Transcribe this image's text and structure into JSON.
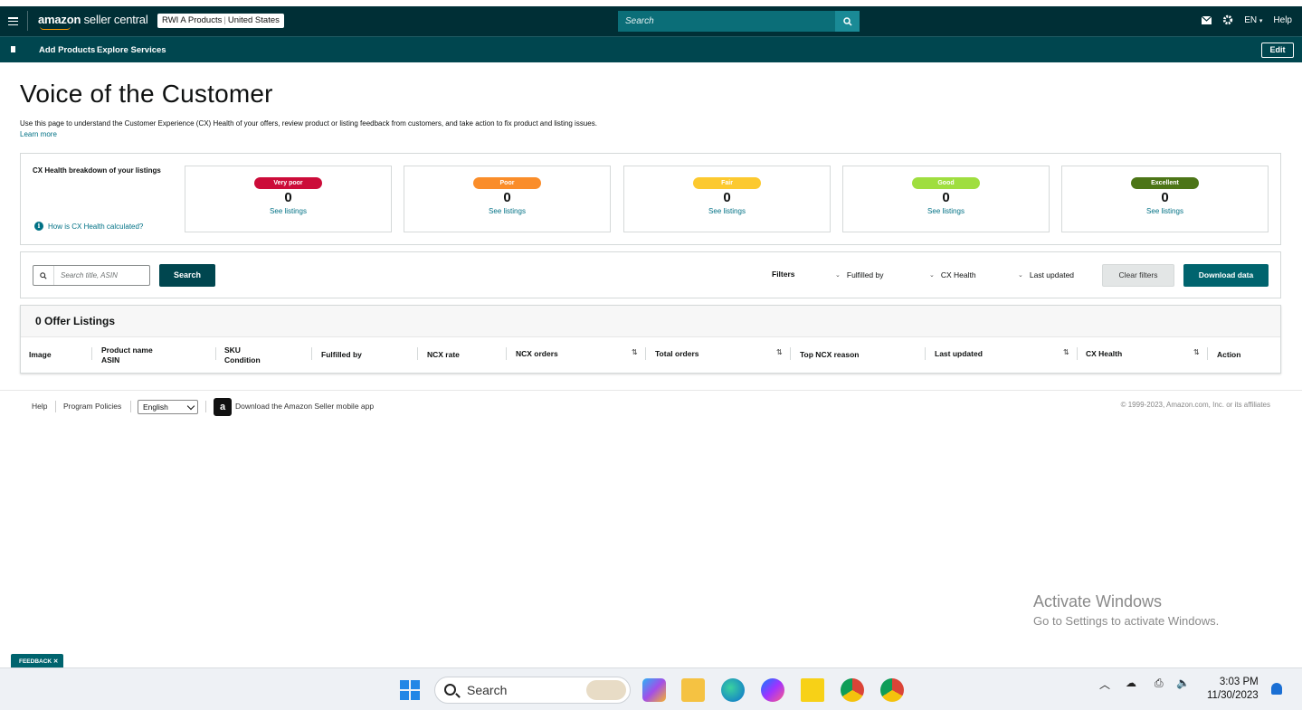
{
  "nav": {
    "logo_prefix": "amazon",
    "logo_suffix": "seller central",
    "account_name": "RWI A Products",
    "account_region": "United States",
    "search_placeholder": "Search",
    "lang": "EN",
    "help": "Help"
  },
  "subnav": {
    "links": [
      "Add Products",
      "Explore Services"
    ],
    "edit": "Edit"
  },
  "page": {
    "title": "Voice of the Customer",
    "description": "Use this page to understand the Customer Experience (CX) Health of your offers, review product or listing feedback from customers, and take action to fix product and listing issues.",
    "learn_more": "Learn more"
  },
  "breakdown": {
    "title": "CX Health breakdown of your listings",
    "help_link": "How is CX Health calculated?",
    "cards": [
      {
        "label": "Very poor",
        "count": "0",
        "link": "See listings",
        "color": "#cc0c39"
      },
      {
        "label": "Poor",
        "count": "0",
        "link": "See listings",
        "color": "#fa8d2a"
      },
      {
        "label": "Fair",
        "count": "0",
        "link": "See listings",
        "color": "#fcc92f"
      },
      {
        "label": "Good",
        "count": "0",
        "link": "See listings",
        "color": "#9fde3f"
      },
      {
        "label": "Excellent",
        "count": "0",
        "link": "See listings",
        "color": "#4c7517"
      }
    ]
  },
  "filters": {
    "search_placeholder": "Search title, ASIN",
    "search_button": "Search",
    "label": "Filters",
    "dropdowns": [
      "Fulfilled by",
      "CX Health",
      "Last updated"
    ],
    "clear": "Clear filters",
    "download": "Download data"
  },
  "listings": {
    "header": "0 Offer Listings",
    "columns": {
      "image": "Image",
      "product_name": "Product name",
      "asin": "ASIN",
      "sku": "SKU",
      "condition": "Condition",
      "fulfilled_by": "Fulfilled by",
      "ncx_rate": "NCX rate",
      "ncx_orders": "NCX orders",
      "total_orders": "Total orders",
      "top_ncx_reason": "Top NCX reason",
      "last_updated": "Last updated",
      "cx_health": "CX Health",
      "action": "Action"
    }
  },
  "footer": {
    "help": "Help",
    "policies": "Program Policies",
    "language": "English",
    "app_text": "Download the Amazon Seller mobile app",
    "copyright": "© 1999-2023, Amazon.com, Inc. or its affiliates"
  },
  "watermark": {
    "line1": "Activate Windows",
    "line2": "Go to Settings to activate Windows."
  },
  "feedback": "FEEDBACK ✕",
  "taskbar": {
    "search": "Search",
    "time": "3:03 PM",
    "date": "11/30/2023"
  },
  "colors": {
    "nav_dark": "#002f36",
    "nav_sub": "#00464f",
    "link": "#007185",
    "primary_button": "#00646e"
  }
}
